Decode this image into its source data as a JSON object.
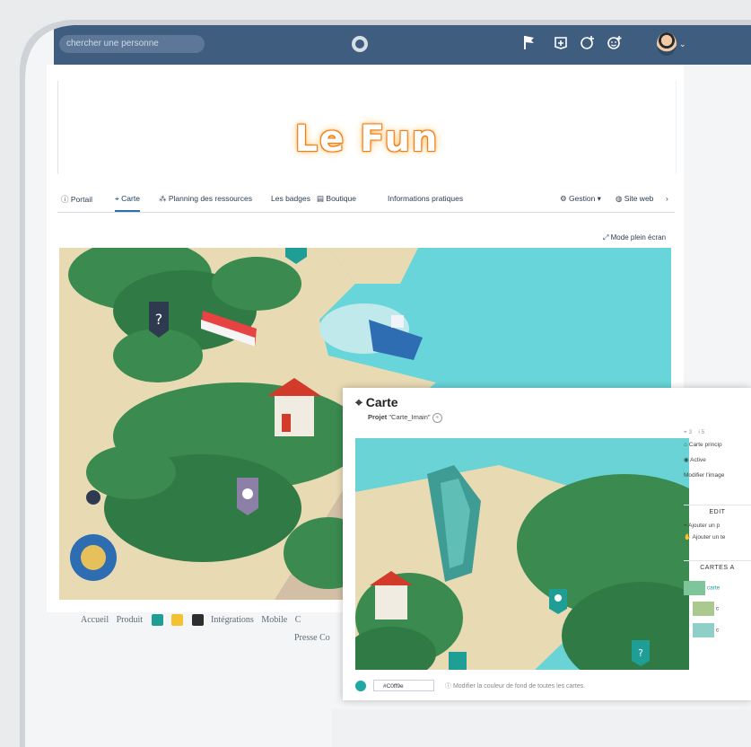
{
  "header": {
    "search_placeholder": "chercher une personne",
    "icons": [
      "flag-icon",
      "add-group-icon",
      "add-team-icon",
      "add-emoji-icon",
      "avatar",
      "chevron-down-icon"
    ],
    "chevron": "⌄"
  },
  "banner": {
    "title": "Le Fun"
  },
  "tabs": [
    {
      "label": "Portail",
      "icon": "ⓘ"
    },
    {
      "label": "Carte",
      "icon": "⚲"
    },
    {
      "label": "Planning des ressources",
      "icon": "⁂"
    },
    {
      "label": "Les badges",
      "icon": ""
    },
    {
      "label": "Boutique",
      "icon": "▤"
    },
    {
      "label": "Informations pratiques",
      "icon": ""
    }
  ],
  "tab_right": {
    "gestion": "Gestion",
    "site_web": "Site web",
    "chevron": "›"
  },
  "fullscreen": {
    "label": "Mode plein écran"
  },
  "footer": {
    "links": [
      "Accueil",
      "Produit",
      "Intégrations",
      "Mobile",
      "C"
    ],
    "links2": [
      "Presse",
      "Co"
    ]
  },
  "map_editor": {
    "title": "Carte",
    "project_label": "Projet",
    "project_name": "\"Carte_Imain\"",
    "stats": [
      "3",
      "5"
    ],
    "side": {
      "main_map": "Carte princip",
      "active": "Active",
      "modify_image": "Modifier l'image",
      "edit_header": "EDIT",
      "add_point": "Ajouter un p",
      "add_text": "Ajouter un te",
      "maps_header": "CARTES A",
      "maps": [
        "carte",
        "c",
        "c"
      ]
    },
    "footer": {
      "hex_value": "#C0ff9e",
      "note": "Modifier la couleur de fond de toutes les cartes."
    }
  },
  "colors": {
    "topbar": "#3e5d7f",
    "sea": "#67d5d9",
    "sand": "#e8dbb4",
    "forest": "#3a8a4e",
    "accent_orange": "#f07f1a",
    "marker_teal": "#1f9e96",
    "marker_purple": "#6f6388"
  }
}
